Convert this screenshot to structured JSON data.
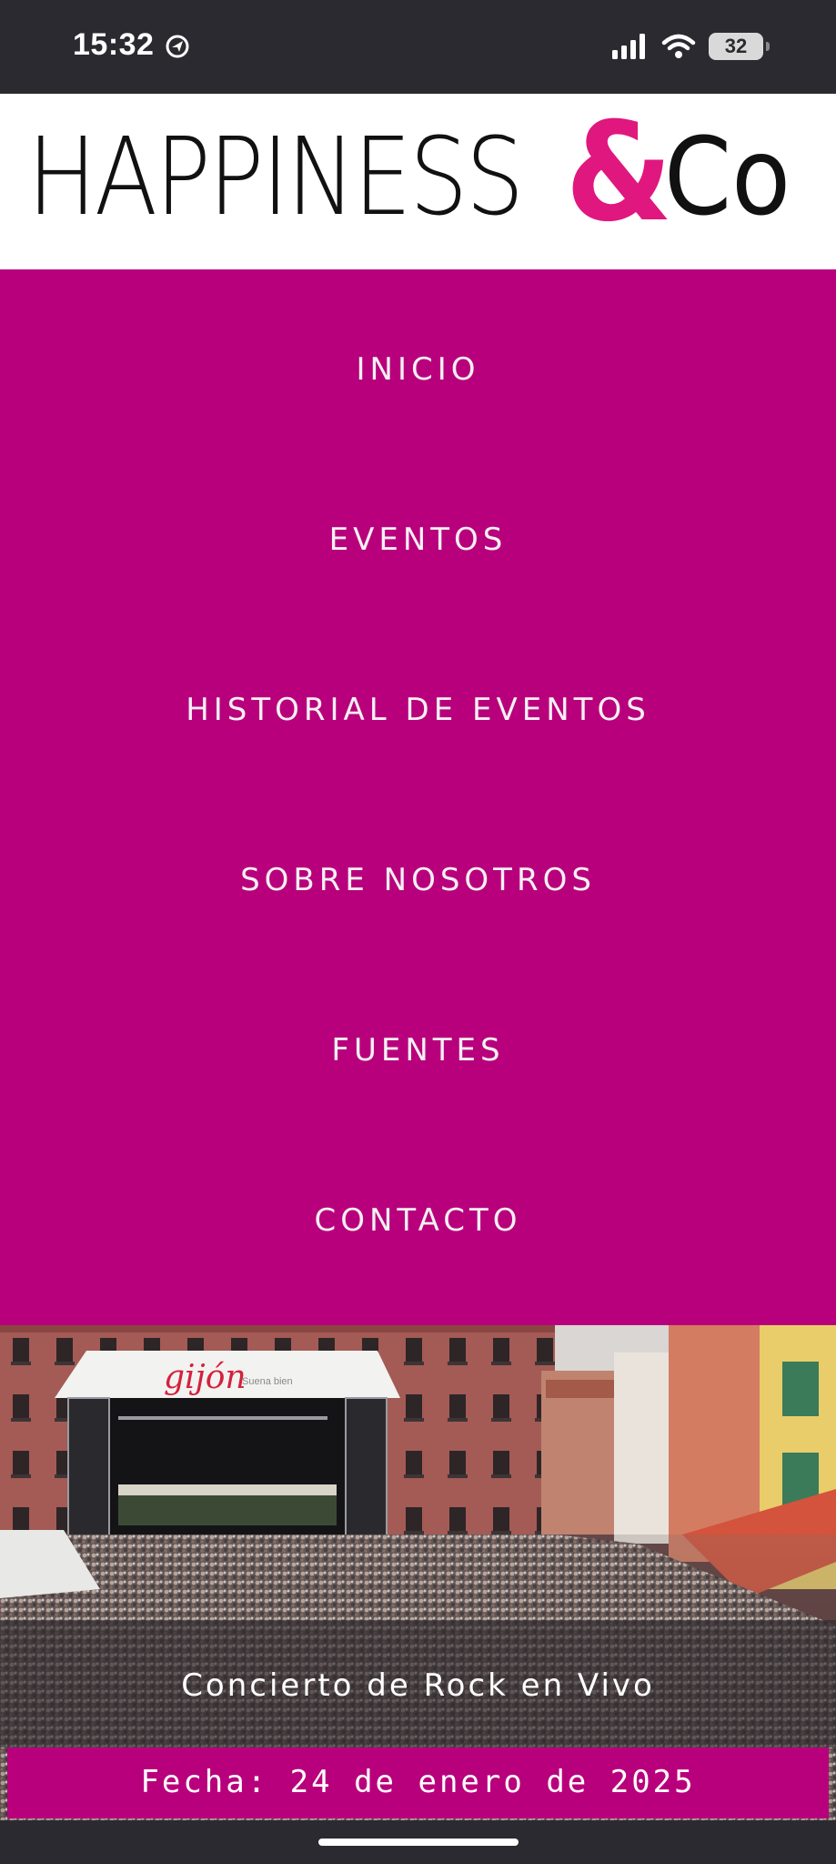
{
  "status_bar": {
    "time": "15:32",
    "battery": "32",
    "icons": [
      "location-icon",
      "signal-icon",
      "wifi-icon",
      "battery-icon"
    ]
  },
  "brand": {
    "name_main": "HAPPINESS",
    "ampersand": "&",
    "name_suffix": "Co",
    "accent_color": "#e0177f"
  },
  "nav": {
    "background": "#b9007c",
    "items": [
      {
        "label": "INICIO"
      },
      {
        "label": "EVENTOS"
      },
      {
        "label": "HISTORIAL DE EVENTOS"
      },
      {
        "label": "SOBRE NOSOTROS"
      },
      {
        "label": "FUENTES"
      },
      {
        "label": "CONTACTO"
      }
    ]
  },
  "hero": {
    "stage_banner": "gijón",
    "stage_banner_sub": "Suena bien",
    "event_title": "Concierto de Rock en Vivo",
    "event_date": "Fecha: 24 de enero de 2025"
  }
}
